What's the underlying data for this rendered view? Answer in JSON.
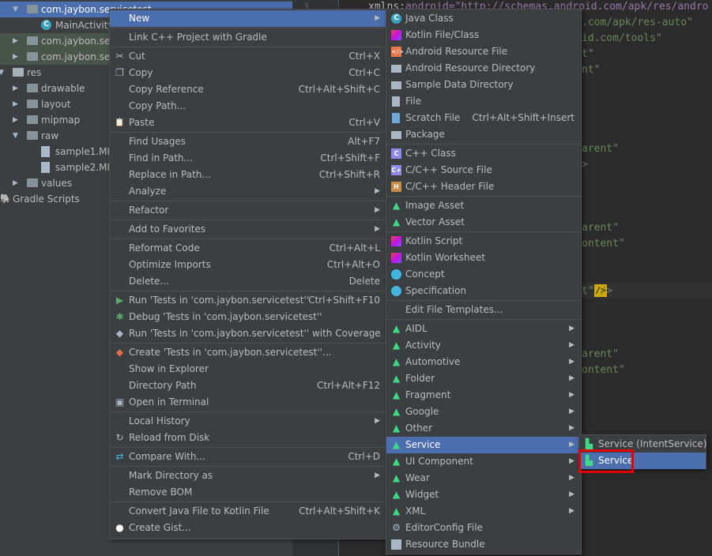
{
  "tree": {
    "rows": [
      {
        "label": "com.jaybon.servicetest",
        "kind": "package",
        "expanded": true
      },
      {
        "label": "MainActivity",
        "kind": "class"
      },
      {
        "label": "com.jaybon.serv",
        "kind": "package",
        "expanded": false
      },
      {
        "label": "com.jaybon.serv",
        "kind": "package",
        "expanded": false
      },
      {
        "label": "res",
        "kind": "res",
        "expanded": true
      },
      {
        "label": "drawable",
        "kind": "folder",
        "expanded": false
      },
      {
        "label": "layout",
        "kind": "folder",
        "expanded": false
      },
      {
        "label": "mipmap",
        "kind": "folder",
        "expanded": false
      },
      {
        "label": "raw",
        "kind": "folder",
        "expanded": true
      },
      {
        "label": "sample1.MP3",
        "kind": "file"
      },
      {
        "label": "sample2.MP3",
        "kind": "file"
      },
      {
        "label": "values",
        "kind": "folder",
        "expanded": false
      },
      {
        "label": "Gradle Scripts",
        "kind": "gradle",
        "expanded": false
      }
    ]
  },
  "gutter": {
    "line_number": "3"
  },
  "editor": {
    "lines": [
      {
        "attr": "xmlns:",
        "val": "android=\"http://schemas.android.com/apk/res/andro"
      },
      {
        "attr": "",
        "val": ".com/apk/res-auto\""
      },
      {
        "attr": "",
        "val": "id.com/tools\""
      },
      {
        "attr": "",
        "val": "t\""
      },
      {
        "attr": "",
        "val": "nt\""
      },
      {
        "attr": "",
        "val": "arent\""
      },
      {
        "attr": "",
        "val": ">"
      },
      {
        "attr": "",
        "val": "arent\""
      },
      {
        "attr": "",
        "val": "ontent\""
      },
      {
        "attr": "",
        "val": "t\" />"
      },
      {
        "attr": "",
        "val": "arent\""
      },
      {
        "attr": "",
        "val": "ontent\""
      },
      {
        "attr": "",
        "val": "Service"
      }
    ]
  },
  "context_menu": {
    "items": [
      {
        "label": "New",
        "submenu": true,
        "active": true
      },
      {
        "sep": true
      },
      {
        "label": "Link C++ Project with Gradle"
      },
      {
        "sep": true
      },
      {
        "label": "Cut",
        "shortcut": "Ctrl+X",
        "icon": "cut-icon"
      },
      {
        "label": "Copy",
        "shortcut": "Ctrl+C",
        "icon": "copy-icon"
      },
      {
        "label": "Copy Reference",
        "shortcut": "Ctrl+Alt+Shift+C"
      },
      {
        "label": "Copy Path...",
        "shortcut": ""
      },
      {
        "label": "Paste",
        "shortcut": "Ctrl+V",
        "icon": "paste-icon"
      },
      {
        "sep": true
      },
      {
        "label": "Find Usages",
        "shortcut": "Alt+F7"
      },
      {
        "label": "Find in Path...",
        "shortcut": "Ctrl+Shift+F"
      },
      {
        "label": "Replace in Path...",
        "shortcut": "Ctrl+Shift+R"
      },
      {
        "label": "Analyze",
        "submenu": true
      },
      {
        "sep": true
      },
      {
        "label": "Refactor",
        "submenu": true
      },
      {
        "sep": true
      },
      {
        "label": "Add to Favorites",
        "submenu": true
      },
      {
        "sep": true
      },
      {
        "label": "Reformat Code",
        "shortcut": "Ctrl+Alt+L"
      },
      {
        "label": "Optimize Imports",
        "shortcut": "Ctrl+Alt+O"
      },
      {
        "label": "Delete...",
        "shortcut": "Delete"
      },
      {
        "sep": true
      },
      {
        "label": "Run 'Tests in 'com.jaybon.servicetest''",
        "shortcut": "Ctrl+Shift+F10",
        "icon": "run-icon"
      },
      {
        "label": "Debug 'Tests in 'com.jaybon.servicetest''",
        "icon": "debug-icon"
      },
      {
        "label": "Run 'Tests in 'com.jaybon.servicetest'' with Coverage",
        "icon": "coverage-icon"
      },
      {
        "sep": true
      },
      {
        "label": "Create 'Tests in 'com.jaybon.servicetest''...",
        "icon": "create-test-icon"
      },
      {
        "label": "Show in Explorer"
      },
      {
        "label": "Directory Path",
        "shortcut": "Ctrl+Alt+F12"
      },
      {
        "label": "Open in Terminal",
        "icon": "terminal-icon"
      },
      {
        "sep": true
      },
      {
        "label": "Local History",
        "submenu": true
      },
      {
        "label": "Reload from Disk",
        "icon": "reload-icon"
      },
      {
        "sep": true
      },
      {
        "label": "Compare With...",
        "shortcut": "Ctrl+D",
        "icon": "compare-icon"
      },
      {
        "sep": true
      },
      {
        "label": "Mark Directory as",
        "submenu": true
      },
      {
        "label": "Remove BOM"
      },
      {
        "sep": true
      },
      {
        "label": "Convert Java File to Kotlin File",
        "shortcut": "Ctrl+Alt+Shift+K"
      },
      {
        "label": "Create Gist...",
        "icon": "github-icon"
      }
    ]
  },
  "new_menu": {
    "items": [
      {
        "label": "Java Class",
        "icon": "java-class-icon"
      },
      {
        "label": "Kotlin File/Class",
        "icon": "kotlin-icon"
      },
      {
        "label": "Android Resource File",
        "icon": "resource-file-icon"
      },
      {
        "label": "Android Resource Directory",
        "icon": "folder-icon"
      },
      {
        "label": "Sample Data Directory",
        "icon": "folder-icon"
      },
      {
        "label": "File",
        "icon": "file-icon"
      },
      {
        "label": "Scratch File",
        "shortcut": "Ctrl+Alt+Shift+Insert",
        "icon": "scratch-file-icon"
      },
      {
        "label": "Package",
        "icon": "package-icon"
      },
      {
        "sep": true
      },
      {
        "label": "C++ Class",
        "icon": "cpp-class-icon"
      },
      {
        "label": "C/C++ Source File",
        "icon": "cpp-source-icon"
      },
      {
        "label": "C/C++ Header File",
        "icon": "cpp-header-icon"
      },
      {
        "sep": true
      },
      {
        "label": "Image Asset",
        "icon": "android-icon"
      },
      {
        "label": "Vector Asset",
        "icon": "android-icon"
      },
      {
        "sep": true
      },
      {
        "label": "Kotlin Script",
        "icon": "kotlin-icon"
      },
      {
        "label": "Kotlin Worksheet",
        "icon": "kotlin-icon"
      },
      {
        "label": "Concept",
        "icon": "concept-icon"
      },
      {
        "label": "Specification",
        "icon": "specification-icon"
      },
      {
        "sep": true
      },
      {
        "label": "Edit File Templates..."
      },
      {
        "sep": true
      },
      {
        "label": "AIDL",
        "icon": "android-icon",
        "submenu": true
      },
      {
        "label": "Activity",
        "icon": "android-icon",
        "submenu": true
      },
      {
        "label": "Automotive",
        "icon": "android-icon",
        "submenu": true
      },
      {
        "label": "Folder",
        "icon": "android-icon",
        "submenu": true
      },
      {
        "label": "Fragment",
        "icon": "android-icon",
        "submenu": true
      },
      {
        "label": "Google",
        "icon": "android-icon",
        "submenu": true
      },
      {
        "label": "Other",
        "icon": "android-icon",
        "submenu": true
      },
      {
        "label": "Service",
        "icon": "android-icon",
        "submenu": true,
        "active": true
      },
      {
        "label": "UI Component",
        "icon": "android-icon",
        "submenu": true
      },
      {
        "label": "Wear",
        "icon": "android-icon",
        "submenu": true
      },
      {
        "label": "Widget",
        "icon": "android-icon",
        "submenu": true
      },
      {
        "label": "XML",
        "icon": "android-icon",
        "submenu": true
      },
      {
        "label": "EditorConfig File",
        "icon": "gear-icon"
      },
      {
        "label": "Resource Bundle",
        "icon": "resource-bundle-icon"
      }
    ]
  },
  "service_menu": {
    "items": [
      {
        "label": "Service (IntentService)",
        "icon": "android-file-icon"
      },
      {
        "label": "Service",
        "icon": "android-file-icon",
        "active": true
      }
    ]
  },
  "colors": {
    "selection": "#4b6eaf",
    "highlight_box": "#e00000",
    "android_green": "#3ddc84"
  }
}
